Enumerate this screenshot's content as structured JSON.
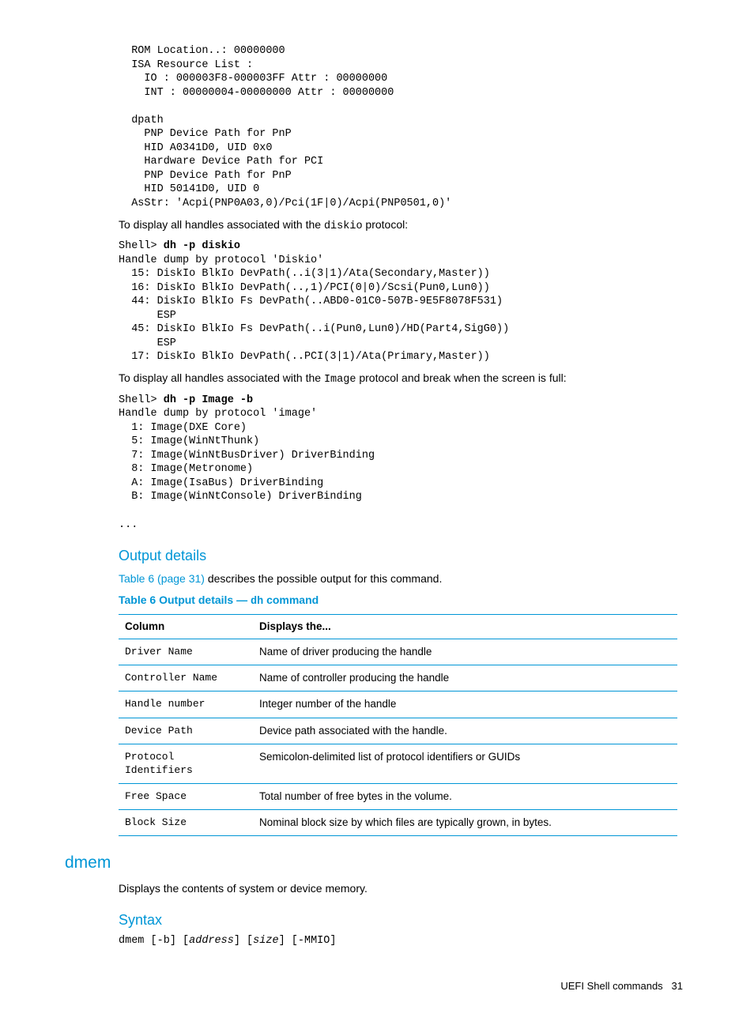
{
  "code1": "  ROM Location..: 00000000\n  ISA Resource List :\n    IO : 000003F8-000003FF Attr : 00000000\n    INT : 00000004-00000000 Attr : 00000000\n\n  dpath\n    PNP Device Path for PnP\n    HID A0341D0, UID 0x0\n    Hardware Device Path for PCI\n    PNP Device Path for PnP\n    HID 50141D0, UID 0\n  AsStr: 'Acpi(PNP0A03,0)/Pci(1F|0)/Acpi(PNP0501,0)'",
  "para1_a": "To display all handles associated with the ",
  "para1_code": "diskio",
  "para1_b": " protocol:",
  "code2_prompt": "Shell> ",
  "code2_cmd": "dh -p diskio",
  "code2_body": "Handle dump by protocol 'Diskio'\n  15: DiskIo BlkIo DevPath(..i(3|1)/Ata(Secondary,Master))\n  16: DiskIo BlkIo DevPath(..,1)/PCI(0|0)/Scsi(Pun0,Lun0))\n  44: DiskIo BlkIo Fs DevPath(..ABD0-01C0-507B-9E5F8078F531)\n      ESP\n  45: DiskIo BlkIo Fs DevPath(..i(Pun0,Lun0)/HD(Part4,SigG0))\n      ESP\n  17: DiskIo BlkIo DevPath(..PCI(3|1)/Ata(Primary,Master))",
  "para2_a": "To display all handles associated with the ",
  "para2_code": "Image",
  "para2_b": " protocol and break when the screen is full:",
  "code3_prompt": "Shell> ",
  "code3_cmd": "dh -p Image -b",
  "code3_body": "Handle dump by protocol 'image'\n  1: Image(DXE Core)\n  5: Image(WinNtThunk)\n  7: Image(WinNtBusDriver) DriverBinding\n  8: Image(Metronome)\n  A: Image(IsaBus) DriverBinding\n  B: Image(WinNtConsole) DriverBinding\n\n...",
  "output_heading": "Output details",
  "output_link": "Table 6 (page 31)",
  "output_text_rest": " describes the possible output for this command.",
  "table_title_a": "Table 6 Output details — ",
  "table_title_code": "dh",
  "table_title_b": " command",
  "th1": "Column",
  "th2": "Displays the...",
  "rows": [
    {
      "c": "Driver Name",
      "d": "Name of driver producing the handle"
    },
    {
      "c": "Controller Name",
      "d": "Name of controller producing the handle"
    },
    {
      "c": "Handle number",
      "d": "Integer number of the handle"
    },
    {
      "c": "Device Path",
      "d": "Device path associated with the handle."
    },
    {
      "c": "Protocol Identifiers",
      "d": "Semicolon-delimited list of protocol identifiers or GUIDs"
    },
    {
      "c": "Free Space",
      "d": "Total number of free bytes in the volume."
    },
    {
      "c": "Block Size",
      "d": "Nominal block size by which files are typically grown, in bytes."
    }
  ],
  "dmem_heading": "dmem",
  "dmem_desc": "Displays the contents of system or device memory.",
  "syntax_heading": "Syntax",
  "syntax_parts": {
    "cmd": "dmem",
    "opt1": " [",
    "b": "-b",
    "close1": "] [",
    "address": "address",
    "close2": "] [",
    "size": "size",
    "close3": "] [",
    "mmio": "-MMIO",
    "close4": "]"
  },
  "footer_text": "UEFI Shell commands",
  "footer_page": "31"
}
